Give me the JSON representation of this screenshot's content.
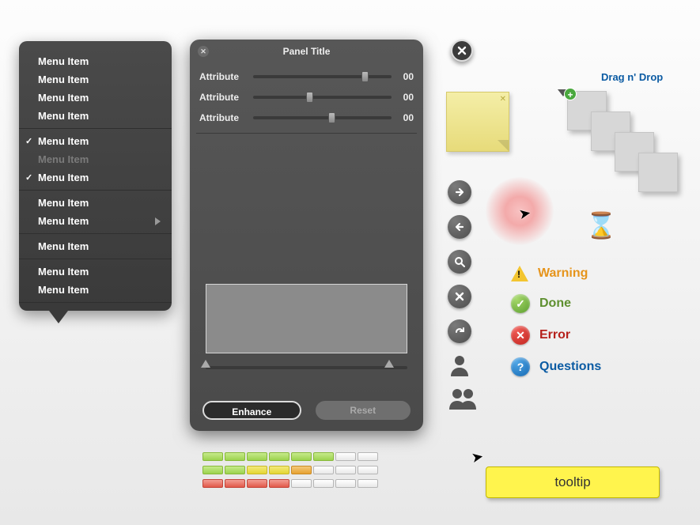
{
  "menu": {
    "groups": [
      [
        {
          "label": "Menu Item"
        },
        {
          "label": "Menu Item"
        },
        {
          "label": "Menu Item"
        },
        {
          "label": "Menu Item"
        }
      ],
      [
        {
          "label": "Menu Item",
          "checked": true
        },
        {
          "label": "Menu Item",
          "disabled": true
        },
        {
          "label": "Menu Item",
          "checked": true
        }
      ],
      [
        {
          "label": "Menu Item"
        },
        {
          "label": "Menu Item",
          "submenu": true
        }
      ],
      [
        {
          "label": "Menu Item"
        }
      ],
      [
        {
          "label": "Menu Item"
        },
        {
          "label": "Menu Item"
        }
      ]
    ]
  },
  "panel": {
    "title": "Panel Title",
    "attributes": [
      {
        "label": "Attribute",
        "value": "00",
        "pos": 0.78
      },
      {
        "label": "Attribute",
        "value": "00",
        "pos": 0.38
      },
      {
        "label": "Attribute",
        "value": "00",
        "pos": 0.54
      }
    ],
    "range": {
      "low": 0.0,
      "high": 0.91
    },
    "buttons": {
      "primary": "Enhance",
      "secondary": "Reset"
    }
  },
  "dragndrop": {
    "title": "Drag n' Drop"
  },
  "status": {
    "warning": "Warning",
    "done": "Done",
    "error": "Error",
    "questions": "Questions"
  },
  "tooltip": {
    "text": "tooltip"
  },
  "progress": {
    "rows": [
      {
        "style": "green",
        "filled": 6,
        "total": 8
      },
      {
        "style": "grad",
        "filled": 5,
        "total": 8
      },
      {
        "style": "red",
        "filled": 4,
        "total": 8
      }
    ]
  }
}
